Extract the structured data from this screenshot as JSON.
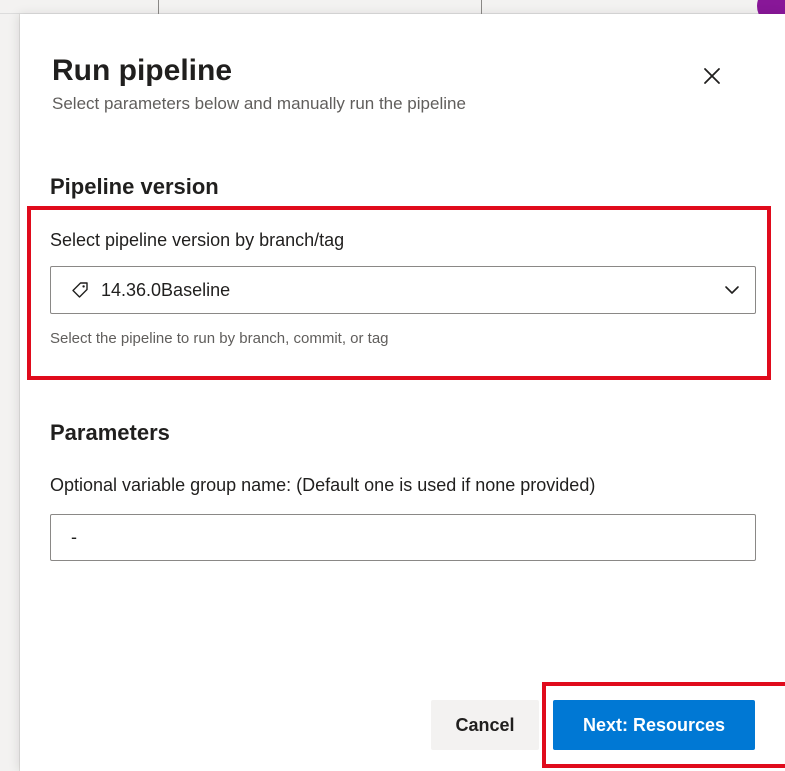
{
  "dialog": {
    "title": "Run pipeline",
    "subtitle": "Select parameters below and manually run the pipeline",
    "close_icon": "close-icon"
  },
  "pipeline_version": {
    "heading": "Pipeline version",
    "field_label": "Select pipeline version by branch/tag",
    "selected_value": "14.36.0Baseline",
    "value_icon": "tag-icon",
    "dropdown_icon": "chevron-down-icon",
    "helper_text": "Select the pipeline to run by branch, commit, or tag"
  },
  "parameters": {
    "heading": "Parameters",
    "variable_group_label": "Optional variable group name: (Default one is used if none provided)",
    "variable_group_value": "-"
  },
  "footer": {
    "cancel_label": "Cancel",
    "next_label": "Next: Resources"
  },
  "colors": {
    "primary": "#0078d4",
    "highlight": "#e00b1c",
    "text": "#201f1e",
    "secondary_text": "#605e5c",
    "avatar": "#881798"
  }
}
